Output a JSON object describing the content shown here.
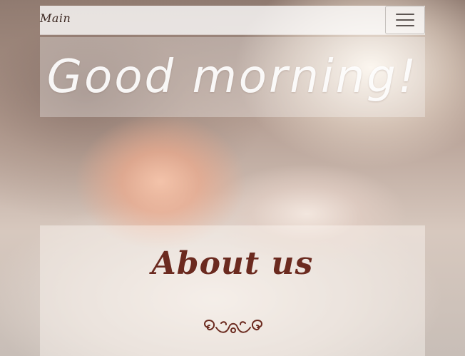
{
  "navbar": {
    "brand": "Main",
    "toggler_icon": "hamburger-menu-icon"
  },
  "hero": {
    "title": "Good morning!"
  },
  "about": {
    "title": "About us",
    "ornament_icon": "flourish-divider-icon"
  },
  "colors": {
    "brand_text": "#3a2620",
    "about_title": "#6b2a1f",
    "ornament": "#6b2a1f",
    "hero_title": "#ffffff"
  }
}
